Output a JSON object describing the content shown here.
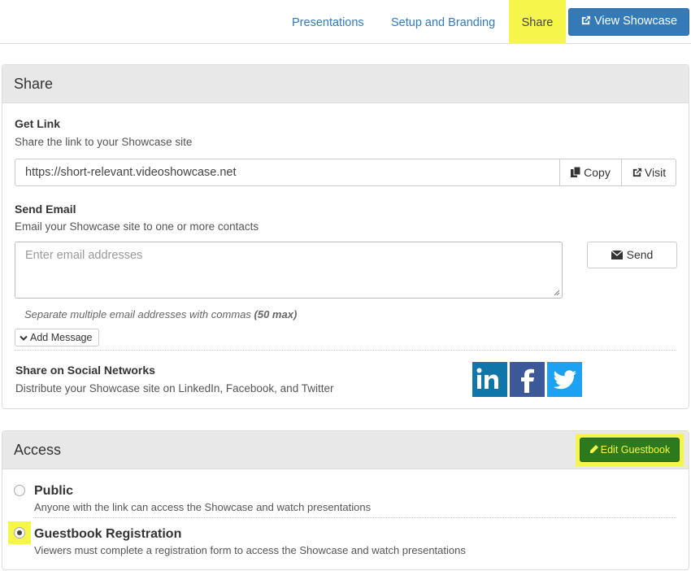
{
  "nav": {
    "presentations": "Presentations",
    "setup": "Setup and Branding",
    "share": "Share",
    "view_showcase": "View Showcase"
  },
  "share_panel": {
    "title": "Share",
    "get_link": {
      "title": "Get Link",
      "desc": "Share the link to your Showcase site",
      "url": "https://short-relevant.videoshowcase.net",
      "copy_label": "Copy",
      "visit_label": "Visit"
    },
    "send_email": {
      "title": "Send Email",
      "desc": "Email your Showcase site to one or more contacts",
      "placeholder": "Enter email addresses",
      "send_label": "Send",
      "hint": "Separate multiple email addresses with commas",
      "hint_max": "(50 max)",
      "add_message_label": "Add Message"
    },
    "social": {
      "title": "Share on Social Networks",
      "desc": "Distribute your Showcase site on LinkedIn, Facebook, and Twitter",
      "networks": [
        "linkedin-icon",
        "facebook-icon",
        "twitter-icon"
      ]
    }
  },
  "access_panel": {
    "title": "Access",
    "edit_guestbook_label": "Edit Guestbook",
    "options": [
      {
        "title": "Public",
        "desc": "Anyone with the link can access the Showcase and watch presentations",
        "selected": false
      },
      {
        "title": "Guestbook Registration",
        "desc": "Viewers must complete a registration form to access the Showcase and watch presentations",
        "selected": true
      }
    ]
  },
  "colors": {
    "link_blue": "#337ab7",
    "highlight_yellow": "#f5f54a",
    "guestbook_green": "#2d7a1e",
    "linkedin": "#0e76a8",
    "facebook": "#3b5998",
    "twitter": "#1da1f2"
  }
}
